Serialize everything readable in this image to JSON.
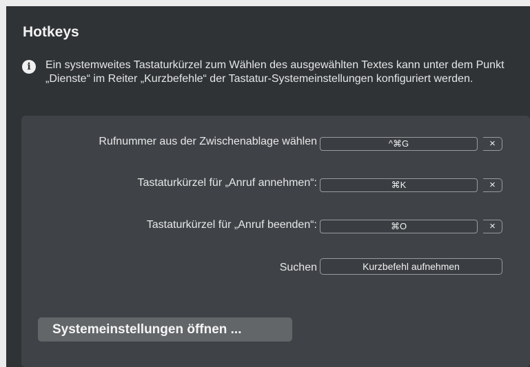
{
  "section": {
    "title": "Hotkeys",
    "info_icon": "info-circle-icon",
    "info_text": "Ein systemweites Tastaturkürzel zum Wählen des ausgewählten Textes kann unter dem Punkt „Dienste“ im Reiter „Kurzbefehle“ der Tastatur-Systemeinstellungen konfiguriert werden."
  },
  "hotkeys": {
    "rows": [
      {
        "label": "Rufnummer aus der Zwischenablage wählen",
        "shortcut": "^⌘G",
        "clear_label": "×"
      },
      {
        "label": "Tastaturkürzel für „Anruf annehmen“:",
        "shortcut": "⌘K",
        "clear_label": "×"
      },
      {
        "label": "Tastaturkürzel für „Anruf beenden“:",
        "shortcut": "⌘O",
        "clear_label": "×"
      }
    ],
    "search": {
      "label": "Suchen",
      "button_label": "Kurzbefehl aufnehmen"
    },
    "open_settings_label": "Systemeinstellungen öffnen ..."
  }
}
